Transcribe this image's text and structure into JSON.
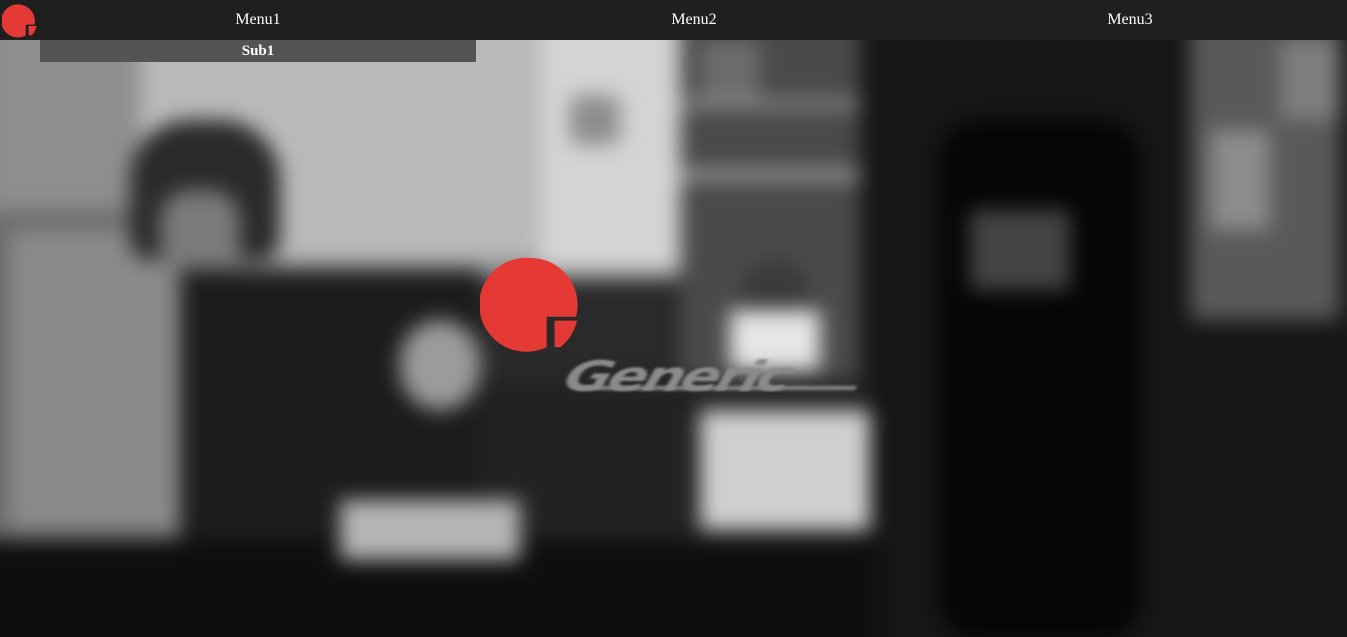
{
  "colors": {
    "navbar_bg": "#1f1f1f",
    "submenu_bg": "#545454",
    "nav_text": "#ffffff",
    "brand_red": "#e53935",
    "brand_gray": "#8a8a8a"
  },
  "header": {
    "logo_icon": "brand-logo-icon",
    "menu": [
      {
        "label": "Menu1",
        "submenu": [
          {
            "label": "Sub1"
          }
        ]
      },
      {
        "label": "Menu2"
      },
      {
        "label": "Menu3"
      }
    ]
  },
  "hero": {
    "brand_icon": "brand-logo-icon",
    "brand_text": "Generic"
  }
}
